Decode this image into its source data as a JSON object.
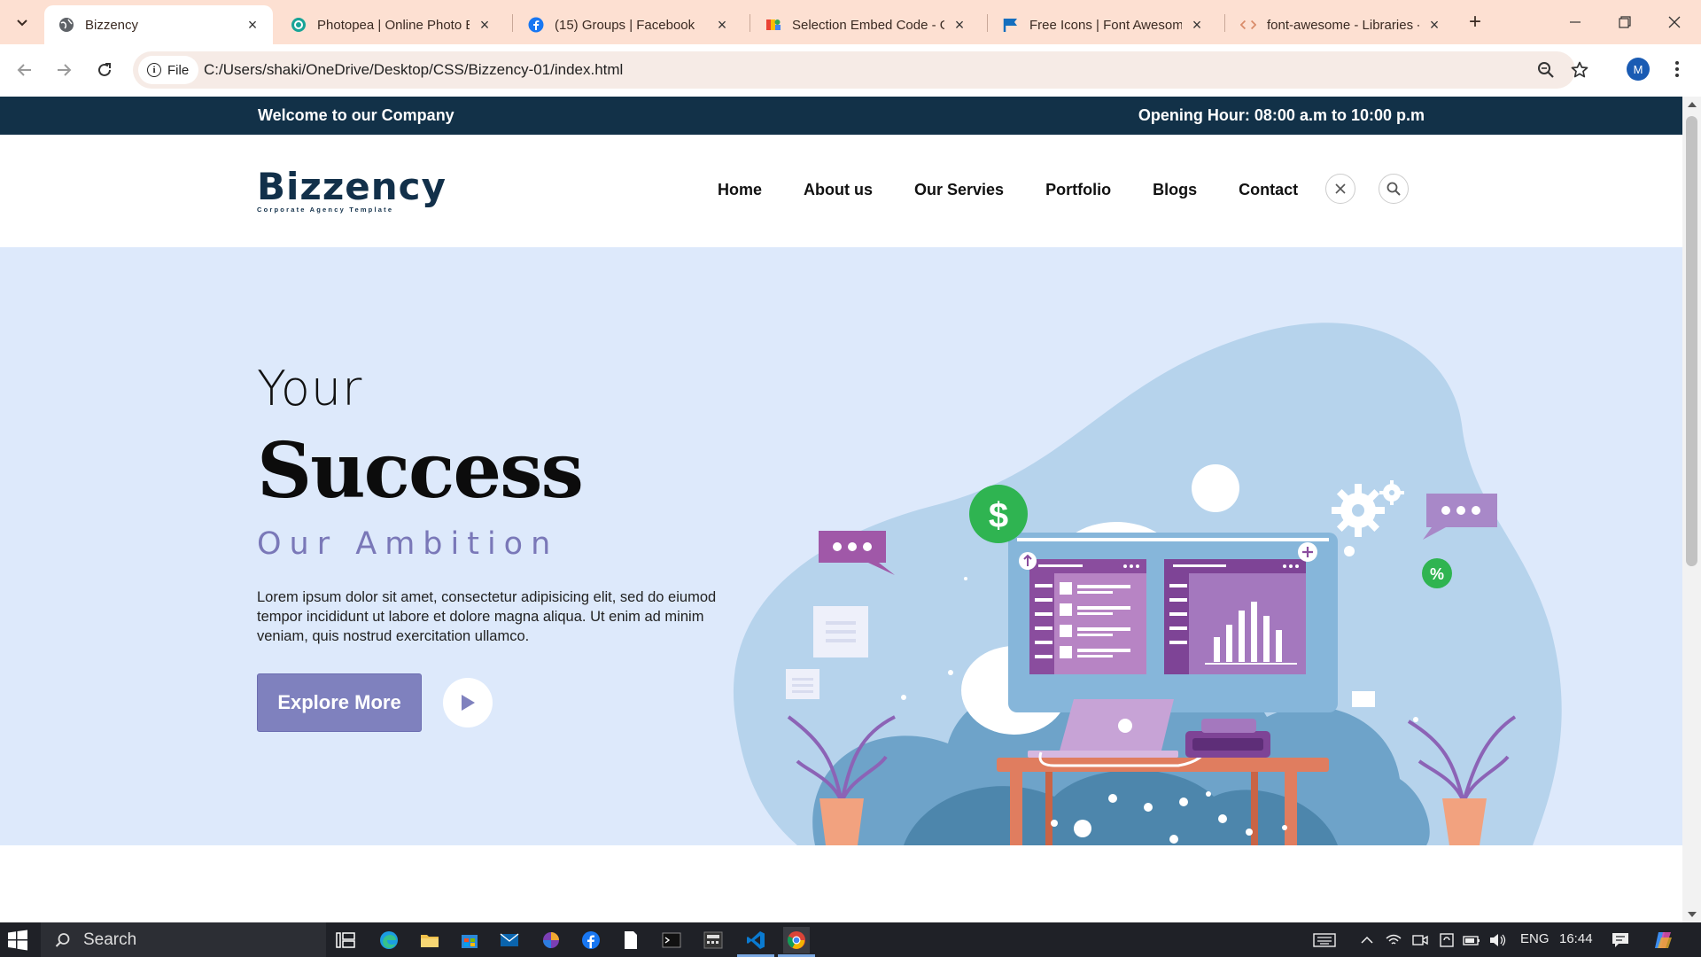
{
  "browser": {
    "tabs": [
      {
        "title": "Bizzency",
        "favicon": "globe-icon",
        "active": true
      },
      {
        "title": "Photopea | Online Photo Editor",
        "favicon": "photopea-icon",
        "active": false
      },
      {
        "title": "(15) Groups | Facebook",
        "favicon": "facebook-icon",
        "active": false
      },
      {
        "title": "Selection Embed Code - Google Fonts",
        "favicon": "google-fonts-icon",
        "active": false
      },
      {
        "title": "Free Icons | Font Awesome",
        "favicon": "font-awesome-flag-icon",
        "active": false
      },
      {
        "title": "font-awesome - Libraries - cdnjs",
        "favicon": "code-icon",
        "active": false
      }
    ],
    "site_info_label": "File",
    "url": "C:/Users/shaki/OneDrive/Desktop/CSS/Bizzency-01/index.html",
    "profile_initial": "M"
  },
  "page": {
    "topbar": {
      "welcome": "Welcome to our Company",
      "hours": "Opening Hour: 08:00 a.m to 10:00 p.m"
    },
    "logo": {
      "brand": "Bizzency",
      "tagline": "Corporate Agency Template"
    },
    "menu": [
      "Home",
      "About us",
      "Our Servies",
      "Portfolio",
      "Blogs",
      "Contact"
    ],
    "hero": {
      "line1": "Your",
      "line2": "Success",
      "line3": "Our Ambition",
      "body": "Lorem ipsum dolor sit amet, consectetur adipisicing elit, sed do eiumod tempor incididunt ut labore et dolore magna aliqua. Ut enim ad minim veniam, quis nostrud exercitation ullamco.",
      "cta": "Explore More"
    }
  },
  "taskbar": {
    "search_placeholder": "Search",
    "language": "ENG",
    "time": "16:44"
  },
  "colors": {
    "tabbar_bg": "#fde0d2",
    "topbar_bg": "#123148",
    "hero_bg": "#dde9fb",
    "accent_purple": "#7f81be",
    "taskbar_bg": "#1f2127"
  }
}
